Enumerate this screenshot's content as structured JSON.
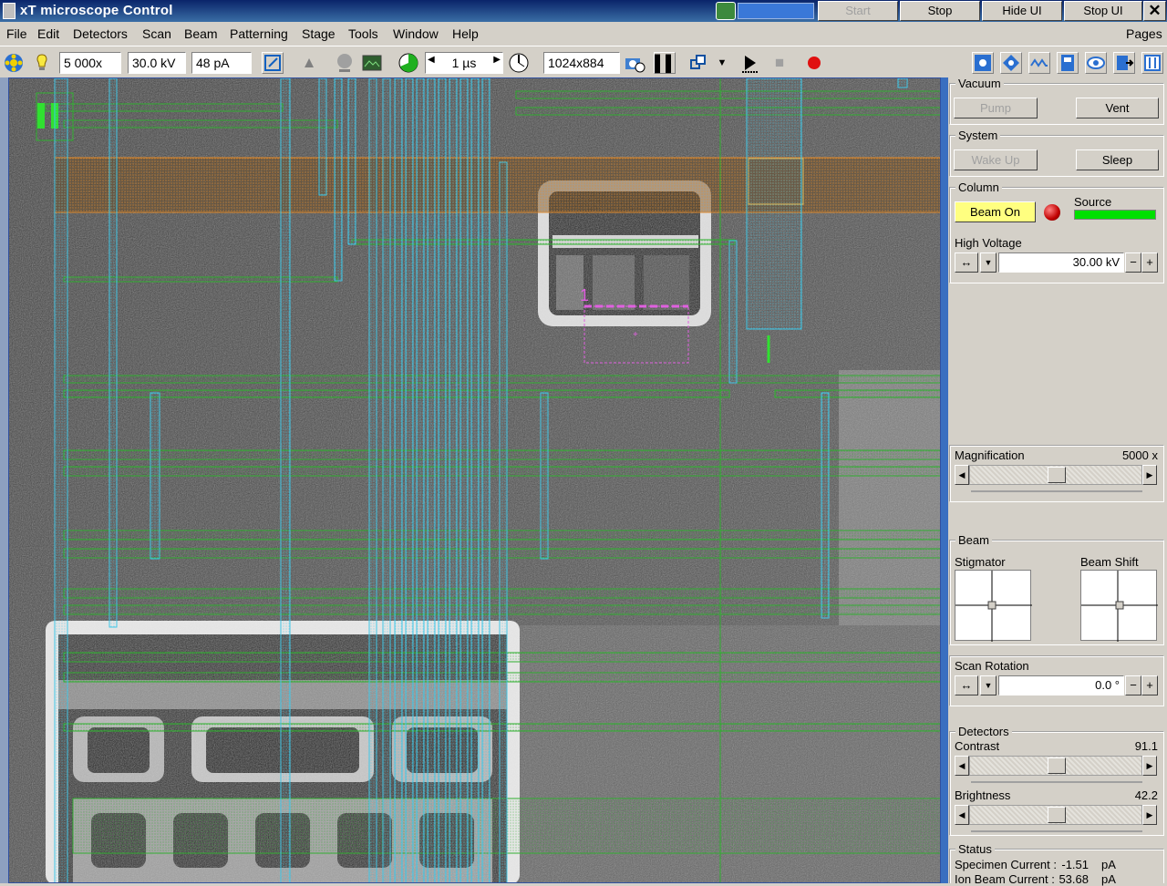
{
  "window": {
    "title": "xT microscope Control",
    "buttons": {
      "start": "Start",
      "stop": "Stop",
      "hide_ui": "Hide UI",
      "stop_ui": "Stop UI",
      "close": "✕"
    }
  },
  "menu": {
    "items": [
      "File",
      "Edit",
      "Detectors",
      "Scan",
      "Beam",
      "Patterning",
      "Stage",
      "Tools",
      "Window",
      "Help"
    ],
    "pages": "Pages"
  },
  "toolbar": {
    "magnification": "5 000x",
    "voltage": "30.0 kV",
    "current": "48 pA",
    "dwell_time": "1 µs",
    "resolution": "1024x884"
  },
  "viewer": {
    "pattern_label": "1",
    "pause_glyph": "▌▌"
  },
  "panel": {
    "vacuum": {
      "title": "Vacuum",
      "pump": "Pump",
      "vent": "Vent"
    },
    "system": {
      "title": "System",
      "wake_up": "Wake Up",
      "sleep": "Sleep"
    },
    "column": {
      "title": "Column",
      "beam_on": "Beam On",
      "source": "Source",
      "high_voltage_label": "High Voltage",
      "high_voltage": "30.00 kV"
    },
    "magnification": {
      "label": "Magnification",
      "value": "5000 x",
      "level": 0.5
    },
    "beam": {
      "title": "Beam",
      "stigmator": "Stigmator",
      "beam_shift": "Beam Shift"
    },
    "scan_rotation": {
      "label": "Scan Rotation",
      "value": "0.0 °"
    },
    "detectors": {
      "title": "Detectors",
      "contrast_label": "Contrast",
      "contrast": "91.1",
      "brightness_label": "Brightness",
      "brightness": "42.2"
    },
    "status": {
      "title": "Status",
      "specimen_label": "Specimen Current :",
      "specimen_value": "-1.51",
      "specimen_unit": "pA",
      "ion_label": "Ion Beam Current :",
      "ion_value": "53.68",
      "ion_unit": "pA"
    }
  },
  "colors": {
    "pattern_cyan": "#3fc8e8",
    "pattern_green": "#2fb02f",
    "pattern_orange": "#e08a2c",
    "pattern_magenta": "#e060e0",
    "beam_on_bg": "#ffff80",
    "source_green": "#00e000"
  }
}
